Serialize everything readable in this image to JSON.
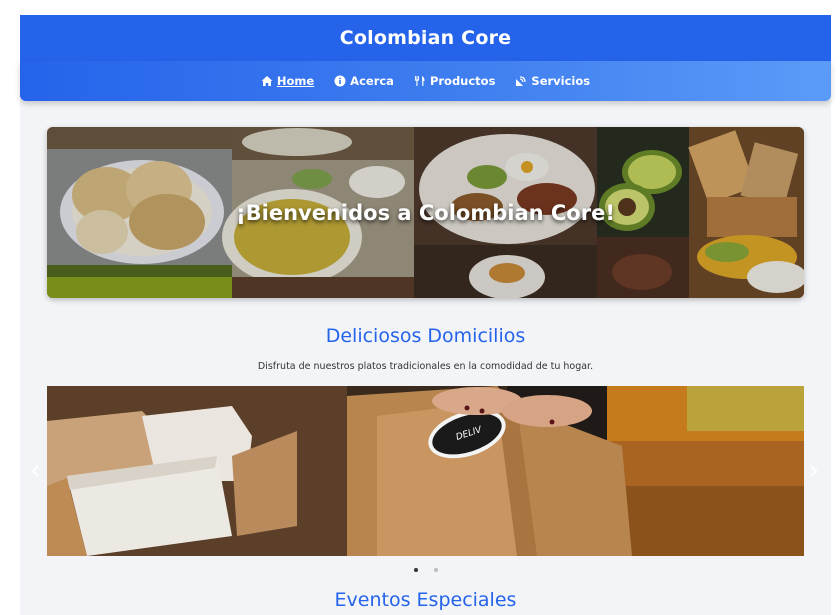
{
  "header": {
    "title": "Colombian Core"
  },
  "nav": {
    "items": [
      {
        "label": "Home",
        "icon": "home-icon",
        "active": true
      },
      {
        "label": "Acerca",
        "icon": "info-icon",
        "active": false
      },
      {
        "label": "Productos",
        "icon": "utensils-icon",
        "active": false
      },
      {
        "label": "Servicios",
        "icon": "satellite-dish-icon",
        "active": false
      }
    ]
  },
  "hero": {
    "title": "¡Bienvenidos a Colombian Core!"
  },
  "delivery": {
    "title": "Deliciosos Domicilios",
    "subtitle": "Disfruta de nuestros platos tradicionales en la comodidad de tu hogar.",
    "sticker_text": "DELIV",
    "slides_total": 2,
    "active_slide": 1
  },
  "events": {
    "title": "Eventos Especiales"
  },
  "colors": {
    "primary": "#2563eb",
    "nav_end": "#5b9bf8",
    "background": "#f2f4f7"
  }
}
